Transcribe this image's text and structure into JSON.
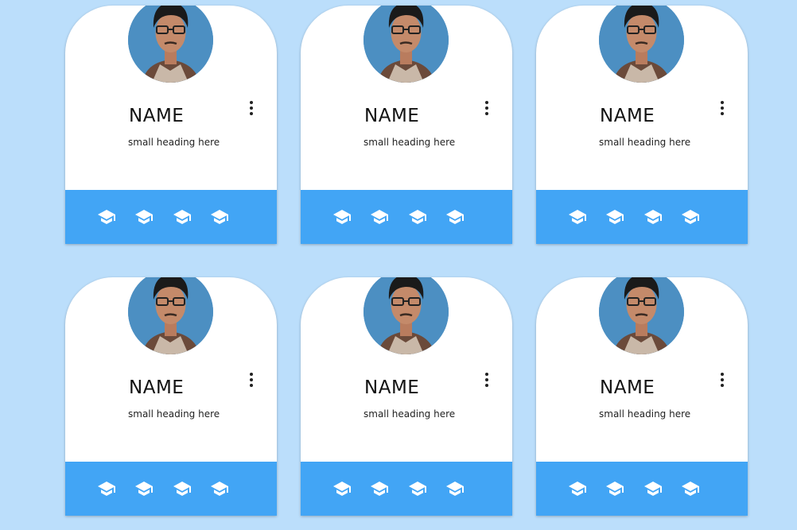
{
  "theme": {
    "background": "#bbdefb",
    "card": "#ffffff",
    "footer": "#42a5f5",
    "icon": "#ffffff"
  },
  "cards": [
    {
      "name": "NAME",
      "subtitle": "small heading here",
      "menu_icon": "more-vert-icon",
      "actions": [
        "graduation-cap-icon",
        "graduation-cap-icon",
        "graduation-cap-icon",
        "graduation-cap-icon"
      ]
    },
    {
      "name": "NAME",
      "subtitle": "small heading here",
      "menu_icon": "more-vert-icon",
      "actions": [
        "graduation-cap-icon",
        "graduation-cap-icon",
        "graduation-cap-icon",
        "graduation-cap-icon"
      ]
    },
    {
      "name": "NAME",
      "subtitle": "small heading here",
      "menu_icon": "more-vert-icon",
      "actions": [
        "graduation-cap-icon",
        "graduation-cap-icon",
        "graduation-cap-icon",
        "graduation-cap-icon"
      ]
    },
    {
      "name": "NAME",
      "subtitle": "small heading here",
      "menu_icon": "more-vert-icon",
      "actions": [
        "graduation-cap-icon",
        "graduation-cap-icon",
        "graduation-cap-icon",
        "graduation-cap-icon"
      ]
    },
    {
      "name": "NAME",
      "subtitle": "small heading here",
      "menu_icon": "more-vert-icon",
      "actions": [
        "graduation-cap-icon",
        "graduation-cap-icon",
        "graduation-cap-icon",
        "graduation-cap-icon"
      ]
    },
    {
      "name": "NAME",
      "subtitle": "small heading here",
      "menu_icon": "more-vert-icon",
      "actions": [
        "graduation-cap-icon",
        "graduation-cap-icon",
        "graduation-cap-icon",
        "graduation-cap-icon"
      ]
    }
  ]
}
